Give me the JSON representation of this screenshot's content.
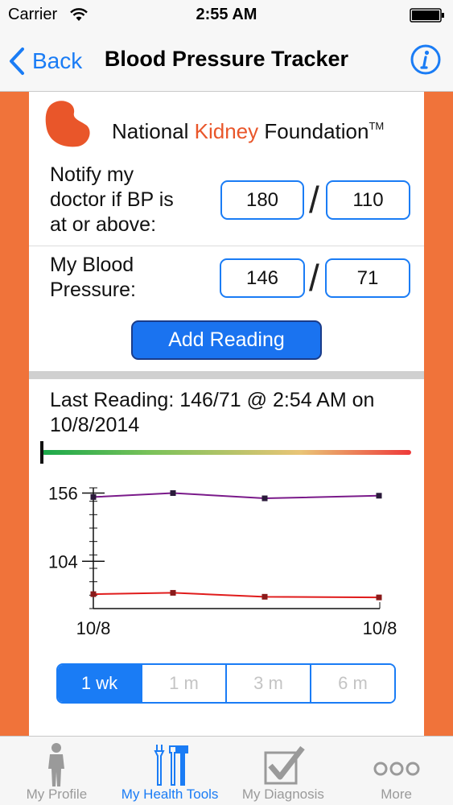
{
  "status_bar": {
    "carrier": "Carrier",
    "time": "2:55 AM"
  },
  "nav": {
    "back_label": "Back",
    "title": "Blood Pressure Tracker"
  },
  "logo": {
    "part1": "National ",
    "part2": "Kidney",
    "part3": " Foundation",
    "tm": "TM"
  },
  "notify": {
    "label_line1": "Notify my",
    "label_line2": "doctor if BP is",
    "label_line3": "at or above:",
    "systolic": "180",
    "diastolic": "110"
  },
  "my_bp": {
    "label_line1": "My Blood",
    "label_line2": "Pressure:",
    "systolic": "146",
    "diastolic": "71"
  },
  "separator": "/",
  "add_button_label": "Add Reading",
  "last_reading": {
    "line1": "Last Reading: 146/71 @ 2:54 AM on",
    "line2": "10/8/2014"
  },
  "colors": {
    "accent": "#1a7cf5",
    "side_orange": "#f0733a",
    "systolic_line": "#7a1a8a",
    "diastolic_line": "#e01c1c"
  },
  "chart_data": {
    "type": "line",
    "y_ticks": [
      "156",
      "104"
    ],
    "x_ticks": [
      "10/8",
      "10/8"
    ],
    "ylim": [
      68,
      160
    ],
    "series": [
      {
        "values": [
          153,
          156,
          152,
          154
        ]
      },
      {
        "values": [
          79,
          80,
          77,
          76.5
        ]
      }
    ]
  },
  "segments": [
    "1 wk",
    "1 m",
    "3 m",
    "6 m"
  ],
  "tabs": [
    {
      "label": "My Profile",
      "icon": "person-icon"
    },
    {
      "label": "My Health Tools",
      "icon": "tools-icon"
    },
    {
      "label": "My Diagnosis",
      "icon": "checkbox-icon"
    },
    {
      "label": "More",
      "icon": "more-icon"
    }
  ]
}
